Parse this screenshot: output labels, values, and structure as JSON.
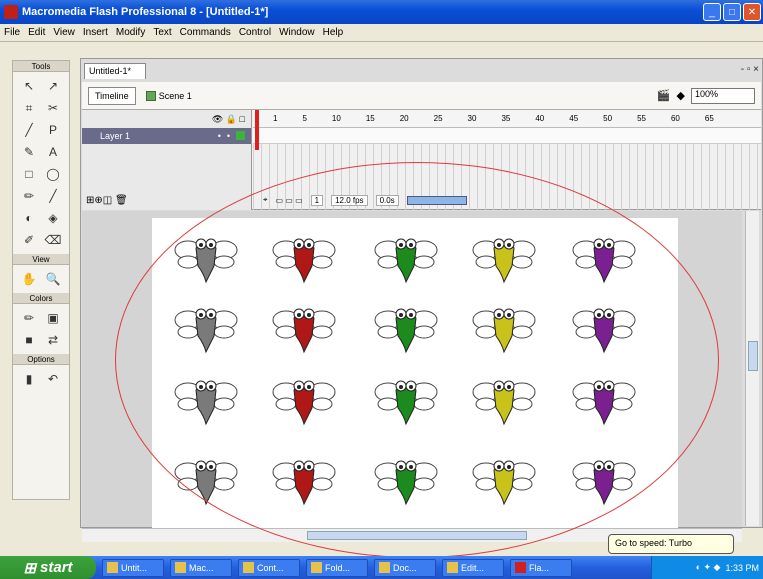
{
  "window": {
    "title": "Macromedia Flash Professional 8 - [Untitled-1*]",
    "buttons": [
      "_",
      "□",
      "✕"
    ]
  },
  "menu": [
    "File",
    "Edit",
    "View",
    "Insert",
    "Modify",
    "Text",
    "Commands",
    "Control",
    "Window",
    "Help"
  ],
  "tools": {
    "sections": [
      "Tools",
      "View",
      "Colors",
      "Options"
    ],
    "tool_glyphs": [
      "↖",
      "↗",
      "⌗",
      "✂",
      "╱",
      "P",
      "✎",
      "A",
      "□",
      "◯",
      "✏",
      "╱",
      "◐",
      "◈",
      "✐",
      "⌫"
    ],
    "view_glyphs": [
      "✋",
      "🔍"
    ],
    "color_glyphs": [
      "✏",
      "▣",
      "■",
      "⇄"
    ],
    "option_glyphs": [
      "▮",
      "↶"
    ]
  },
  "document": {
    "tab": "Untitled-1*",
    "controls": "- ▫ ×"
  },
  "editbar": {
    "scene_button": "Timeline",
    "scene": "Scene 1",
    "zoom": "100%"
  },
  "timeline": {
    "layer_name": "Layer 1",
    "frame_numbers": [
      "1",
      "5",
      "10",
      "15",
      "20",
      "25",
      "30",
      "35",
      "40",
      "45",
      "50",
      "55",
      "60",
      "65"
    ],
    "status": [
      "1",
      "12.0 fps",
      "0.0s"
    ],
    "layer_icons": "👁 🔒 □"
  },
  "bug_colors": [
    "#7a7a7a",
    "#b01818",
    "#1c8a1c",
    "#c8c21a",
    "#7a2090"
  ],
  "taskbar": {
    "start": "start",
    "items": [
      "Untit...",
      "Mac...",
      "Cont...",
      "Fold...",
      "Doc...",
      "Edit...",
      "Fla..."
    ],
    "tray": "1:33 PM",
    "tooltip": "Go to speed: Turbo"
  },
  "annotation_color": "#e03a3a"
}
